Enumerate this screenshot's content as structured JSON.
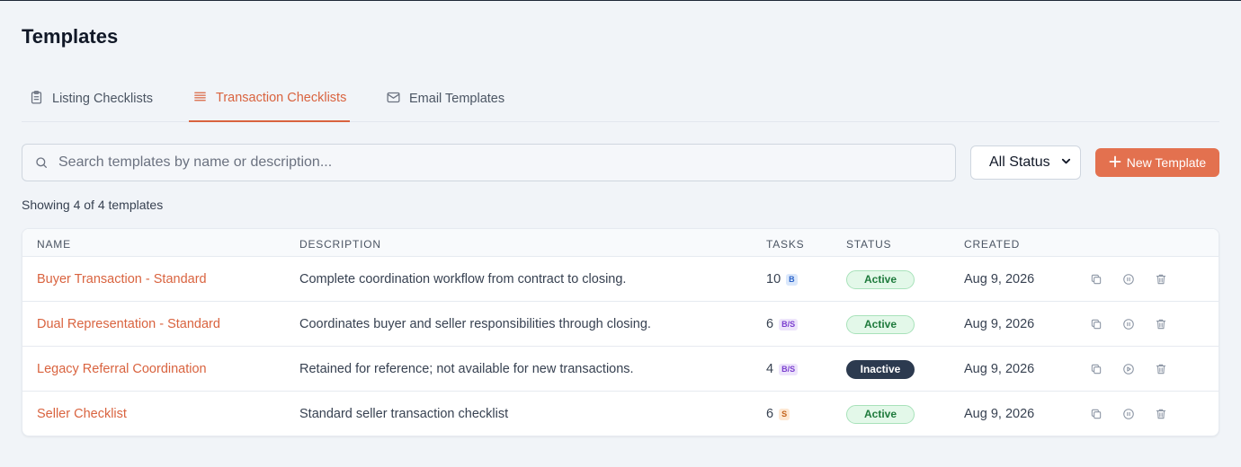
{
  "page": {
    "title": "Templates"
  },
  "tabs": [
    {
      "label": "Listing Checklists",
      "icon": "clipboard-icon",
      "active": false
    },
    {
      "label": "Transaction Checklists",
      "icon": "list-icon",
      "active": true
    },
    {
      "label": "Email Templates",
      "icon": "mail-icon",
      "active": false
    }
  ],
  "search": {
    "placeholder": "Search templates by name or description...",
    "value": ""
  },
  "status_filter": {
    "selected": "All Status"
  },
  "new_template": {
    "label": "New Template"
  },
  "showing_text": "Showing 4 of 4 templates",
  "table": {
    "headers": {
      "name": "NAME",
      "description": "DESCRIPTION",
      "tasks": "TASKS",
      "status": "STATUS",
      "created": "CREATED"
    },
    "rows": [
      {
        "name": "Buyer Transaction - Standard",
        "description": "Complete coordination workflow from contract to closing.",
        "tasks": "10",
        "type": "B",
        "status": "Active",
        "created": "Aug 9, 2026",
        "status_action_icon": "pause-icon"
      },
      {
        "name": "Dual Representation - Standard",
        "description": "Coordinates buyer and seller responsibilities through closing.",
        "tasks": "6",
        "type": "B/S",
        "status": "Active",
        "created": "Aug 9, 2026",
        "status_action_icon": "pause-icon"
      },
      {
        "name": "Legacy Referral Coordination",
        "description": "Retained for reference; not available for new transactions.",
        "tasks": "4",
        "type": "B/S",
        "status": "Inactive",
        "created": "Aug 9, 2026",
        "status_action_icon": "play-icon"
      },
      {
        "name": "Seller Checklist",
        "description": "Standard seller transaction checklist",
        "tasks": "6",
        "type": "S",
        "status": "Active",
        "created": "Aug 9, 2026",
        "status_action_icon": "pause-icon"
      }
    ]
  },
  "colors": {
    "accent": "#d9633f",
    "button": "#e3714f",
    "active_pill_bg": "#e3f8e9",
    "inactive_pill_bg": "#2c3a4f"
  }
}
